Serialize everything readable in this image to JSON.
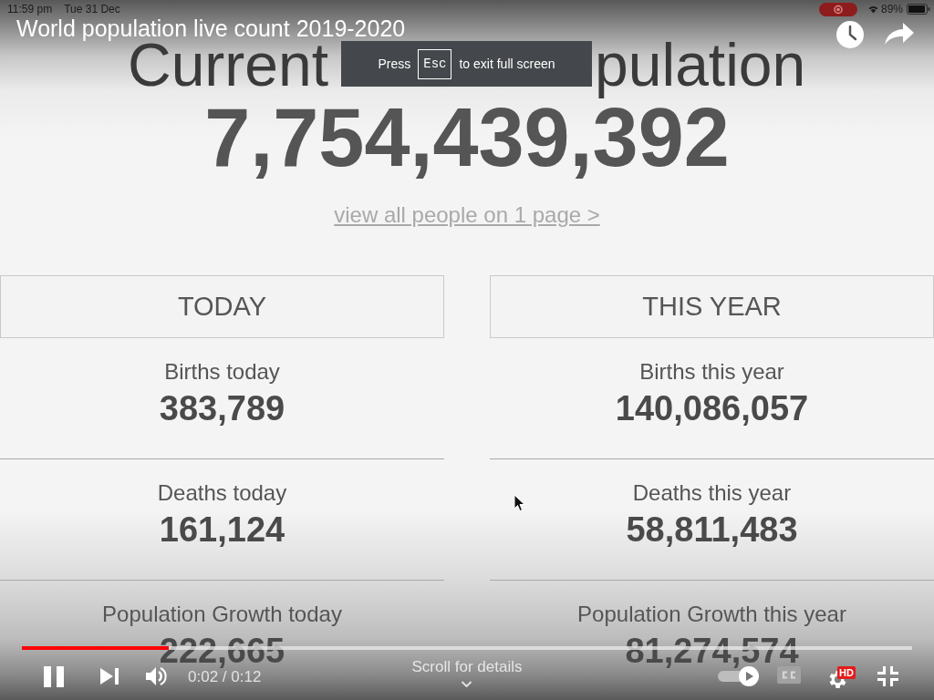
{
  "status_bar": {
    "time": "11:59 pm",
    "date": "Tue 31 Dec",
    "recording": true,
    "battery": "89%"
  },
  "video": {
    "title": "World population live count 2019-2020"
  },
  "toast": {
    "before": "Press",
    "key": "Esc",
    "after": "to exit full screen"
  },
  "page": {
    "heading": {
      "left_of_toast": "Current",
      "right_of_toast": "pulation"
    },
    "count": "7,754,439,392",
    "link": "view all people on 1 page >",
    "panels": [
      {
        "title": "TODAY",
        "stats": [
          {
            "label": "Births today",
            "value": "383,789"
          },
          {
            "label": "Deaths today",
            "value": "161,124"
          },
          {
            "label": "Population Growth today",
            "value": "222,665"
          }
        ]
      },
      {
        "title": "THIS YEAR",
        "stats": [
          {
            "label": "Births this year",
            "value": "140,086,057"
          },
          {
            "label": "Deaths this year",
            "value": "58,811,483"
          },
          {
            "label": "Population Growth this year",
            "value": "81,274,574"
          }
        ]
      }
    ]
  },
  "player": {
    "progress": {
      "level": 0.165
    },
    "playing": true,
    "time": "0:02 / 0:12",
    "hint": "Scroll for details",
    "autoplay": {
      "on": true
    },
    "captions": {
      "on": false
    },
    "quality_badge": "HD"
  }
}
